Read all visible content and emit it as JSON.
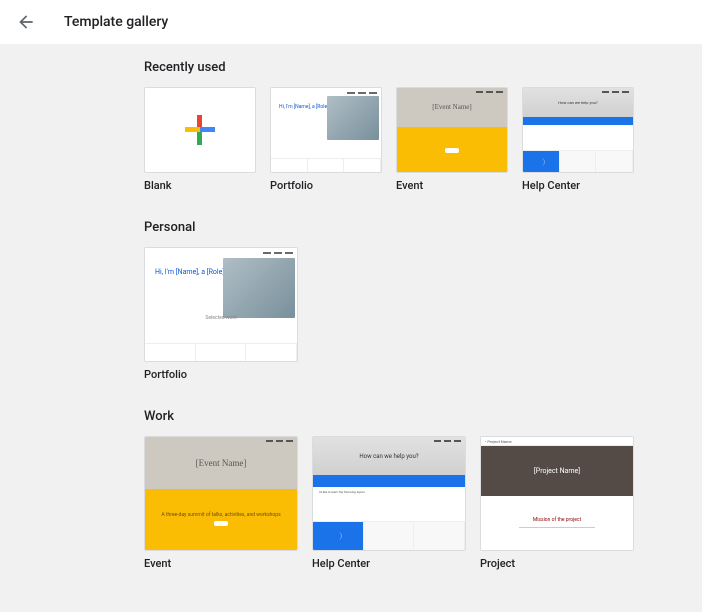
{
  "header": {
    "title": "Template gallery"
  },
  "sections": {
    "recent": {
      "title": "Recently used",
      "items": [
        {
          "label": "Blank"
        },
        {
          "label": "Portfolio",
          "hero_text": "Hi, I'm [Name], a\n[Role] from\n[Location]"
        },
        {
          "label": "Event",
          "hero_text": "[Event Name]"
        },
        {
          "label": "Help Center",
          "hero_text": "How can we help you?"
        }
      ]
    },
    "personal": {
      "title": "Personal",
      "items": [
        {
          "label": "Portfolio",
          "hero_text": "Hi, I'm [Name], a\n[Role] from\n[Location]",
          "sub": "Selected work"
        }
      ]
    },
    "work": {
      "title": "Work",
      "items": [
        {
          "label": "Event",
          "hero_text": "[Event Name]",
          "desc": "A three-day summit of talks, activities, and workshops"
        },
        {
          "label": "Help Center",
          "hero_text": "How can we help you?",
          "mid": "I'd like to learn the following topics"
        },
        {
          "label": "Project",
          "bar": "• Project Name",
          "hero_text": "[Project Name]",
          "mission": "Mission of the project"
        }
      ]
    }
  }
}
